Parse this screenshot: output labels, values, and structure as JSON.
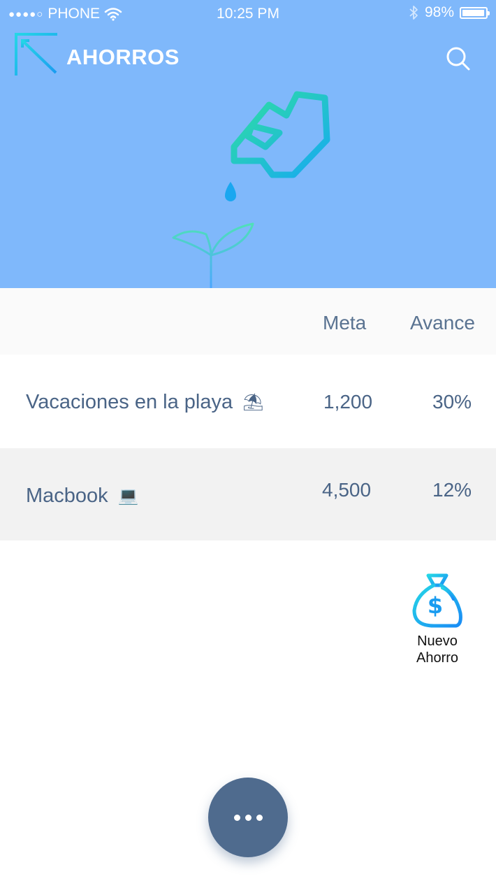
{
  "status_bar": {
    "signal": "●●●●○",
    "carrier": "PHONE",
    "time": "10:25 PM",
    "battery": "98%"
  },
  "header": {
    "title": "AHORROS",
    "logo": "arrow-up-left-icon",
    "search_icon": "search-icon"
  },
  "table": {
    "headers": {
      "meta": "Meta",
      "avance": "Avance"
    },
    "rows": [
      {
        "name": "Vacaciones en la playa",
        "emoji": "⛱",
        "meta": "1,200",
        "avance": "30%"
      },
      {
        "name": "Macbook",
        "emoji": "💻",
        "meta": "4,500",
        "avance": "12%"
      }
    ]
  },
  "new_saving": {
    "label_line1": "Nuevo",
    "label_line2": "Ahorro",
    "icon": "money-bag-icon"
  },
  "fab": {
    "icon": "more-dots-icon"
  },
  "colors": {
    "hero_bg": "#7fb8fb",
    "text": "#4a6486",
    "fab": "#4f6b8e",
    "accent_gradient_start": "#2fd3a0",
    "accent_gradient_end": "#1aa7f0"
  }
}
